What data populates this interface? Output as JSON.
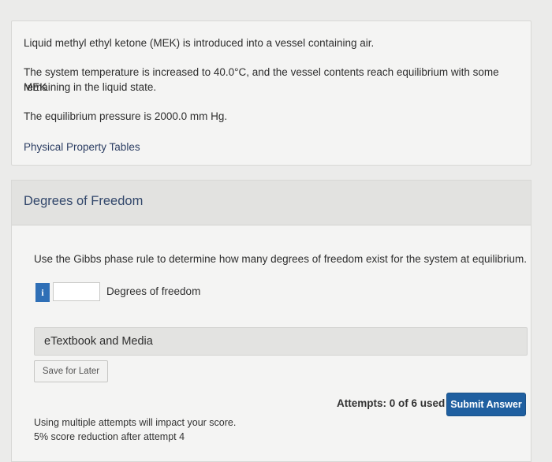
{
  "problem": {
    "line1": "Liquid methyl ethyl ketone (MEK) is introduced into a vessel containing air.",
    "line2a": "The system temperature is increased to 40.0°C, and the vessel contents reach equilibrium with some MEK",
    "line2b": "remaining in the liquid state.",
    "line3": "The equilibrium pressure is 2000.0 mm Hg.",
    "tables_link": "Physical Property Tables"
  },
  "section": {
    "title": "Degrees of Freedom",
    "question": "Use the Gibbs phase rule to determine how many degrees of freedom exist for the system at equilibrium.",
    "info_badge": "i",
    "answer_value": "",
    "answer_label": "Degrees of freedom",
    "etextbook": "eTextbook and Media",
    "save_label": "Save for Later",
    "attempts": "Attempts: 0 of 6 used",
    "submit_label": "Submit Answer",
    "note1": "Using multiple attempts will impact your score.",
    "note2": "5% score reduction after attempt 4"
  }
}
